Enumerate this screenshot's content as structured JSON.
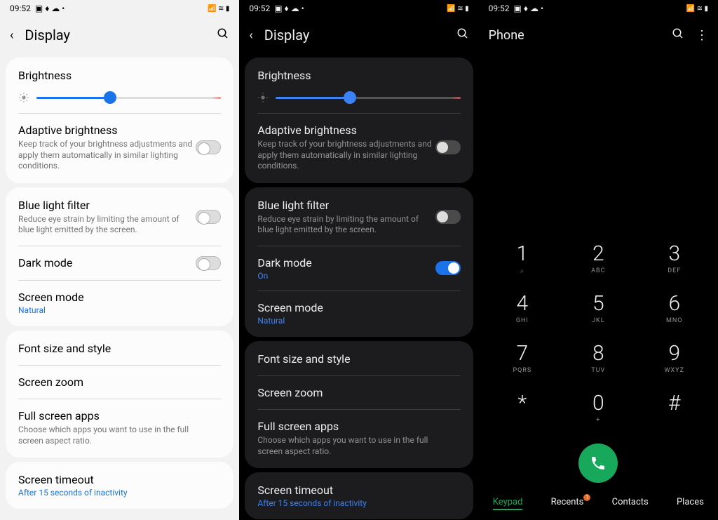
{
  "status": {
    "time": "09:52"
  },
  "settings": {
    "title": "Display",
    "brightness": {
      "label": "Brightness",
      "percent": 40
    },
    "adaptive": {
      "title": "Adaptive brightness",
      "desc": "Keep track of your brightness adjustments and apply them automatically in similar lighting conditions."
    },
    "bluelight": {
      "title": "Blue light filter",
      "desc": "Reduce eye strain by limiting the amount of blue light emitted by the screen."
    },
    "darkmode": {
      "title": "Dark mode",
      "on_label": "On"
    },
    "screenmode": {
      "title": "Screen mode",
      "value": "Natural"
    },
    "font": {
      "title": "Font size and style"
    },
    "zoom": {
      "title": "Screen zoom"
    },
    "fullscreen": {
      "title": "Full screen apps",
      "desc": "Choose which apps you want to use in the full screen aspect ratio."
    },
    "timeout": {
      "title": "Screen timeout",
      "value": "After 15 seconds of inactivity"
    }
  },
  "phone": {
    "title": "Phone",
    "keys": [
      {
        "num": "1",
        "letters": ""
      },
      {
        "num": "2",
        "letters": "ABC"
      },
      {
        "num": "3",
        "letters": "DEF"
      },
      {
        "num": "4",
        "letters": "GHI"
      },
      {
        "num": "5",
        "letters": "JKL"
      },
      {
        "num": "6",
        "letters": "MNO"
      },
      {
        "num": "7",
        "letters": "PQRS"
      },
      {
        "num": "8",
        "letters": "TUV"
      },
      {
        "num": "9",
        "letters": "WXYZ"
      },
      {
        "num": "*",
        "letters": ""
      },
      {
        "num": "0",
        "letters": "+"
      },
      {
        "num": "#",
        "letters": ""
      }
    ],
    "tabs": [
      {
        "label": "Keypad",
        "active": true,
        "badge": ""
      },
      {
        "label": "Recents",
        "active": false,
        "badge": "1"
      },
      {
        "label": "Contacts",
        "active": false,
        "badge": ""
      },
      {
        "label": "Places",
        "active": false,
        "badge": ""
      }
    ]
  }
}
